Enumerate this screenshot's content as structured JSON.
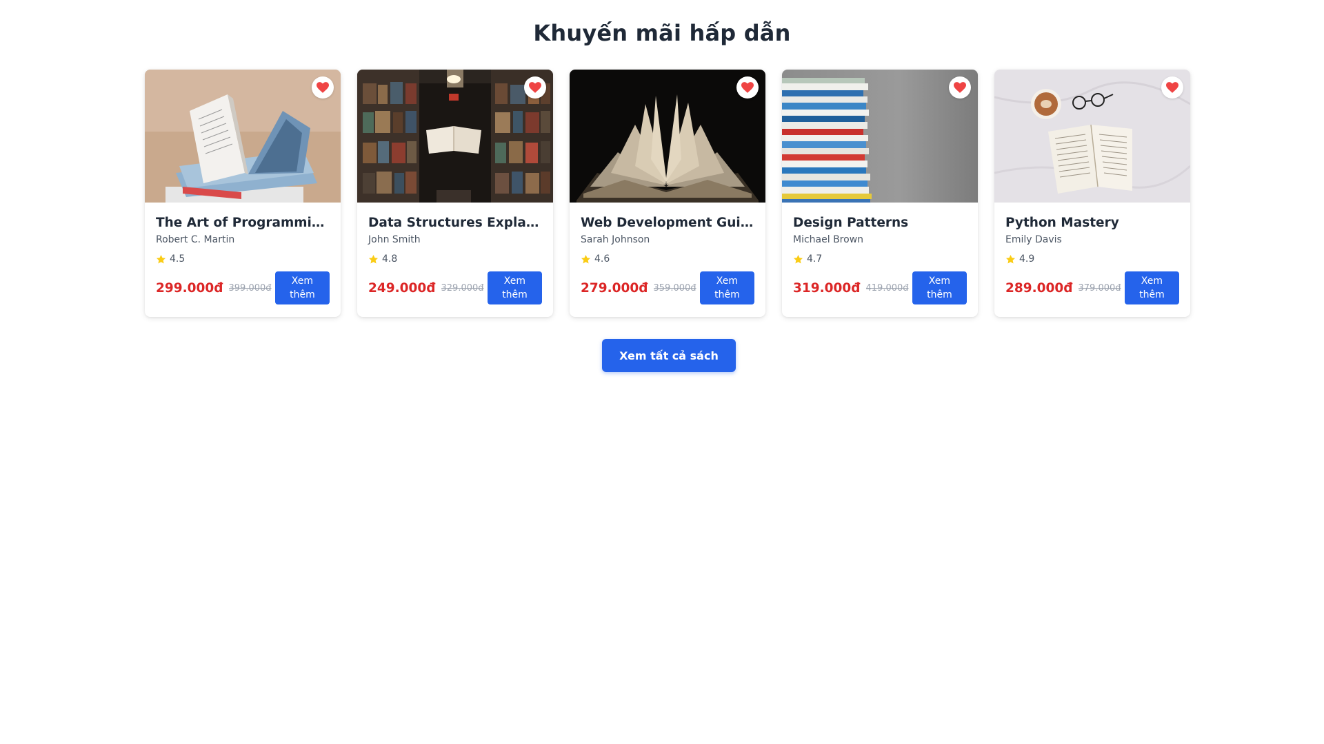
{
  "section": {
    "title": "Khuyến mãi hấp dẫn"
  },
  "colors": {
    "accent": "#2563eb",
    "price": "#dc2626",
    "star": "#facc15",
    "heart": "#ef4444"
  },
  "books": [
    {
      "title": "The Art of Programming",
      "author": "Robert C. Martin",
      "rating": "4.5",
      "price": "299.000đ",
      "old_price": "399.000đ",
      "button": "Xem thêm",
      "button_line1": "Xem",
      "button_line2": "thêm"
    },
    {
      "title": "Data Structures Explai…",
      "author": "John Smith",
      "rating": "4.8",
      "price": "249.000đ",
      "old_price": "329.000đ",
      "button": "Xem thêm",
      "button_line1": "Xem",
      "button_line2": "thêm"
    },
    {
      "title": "Web Development Gui…",
      "author": "Sarah Johnson",
      "rating": "4.6",
      "price": "279.000đ",
      "old_price": "359.000đ",
      "button": "Xem thêm",
      "button_line1": "Xem",
      "button_line2": "thêm"
    },
    {
      "title": "Design Patterns",
      "author": "Michael Brown",
      "rating": "4.7",
      "price": "319.000đ",
      "old_price": "419.000đ",
      "button": "Xem thêm",
      "button_line1": "Xem",
      "button_line2": "thêm"
    },
    {
      "title": "Python Mastery",
      "author": "Emily Davis",
      "rating": "4.9",
      "price": "289.000đ",
      "old_price": "379.000đ",
      "button": "Xem thêm",
      "button_line1": "Xem",
      "button_line2": "thêm"
    }
  ],
  "view_all": {
    "label": "Xem tất cả sách"
  },
  "icons": {
    "favorite": "heart-icon",
    "rating": "star-icon"
  }
}
